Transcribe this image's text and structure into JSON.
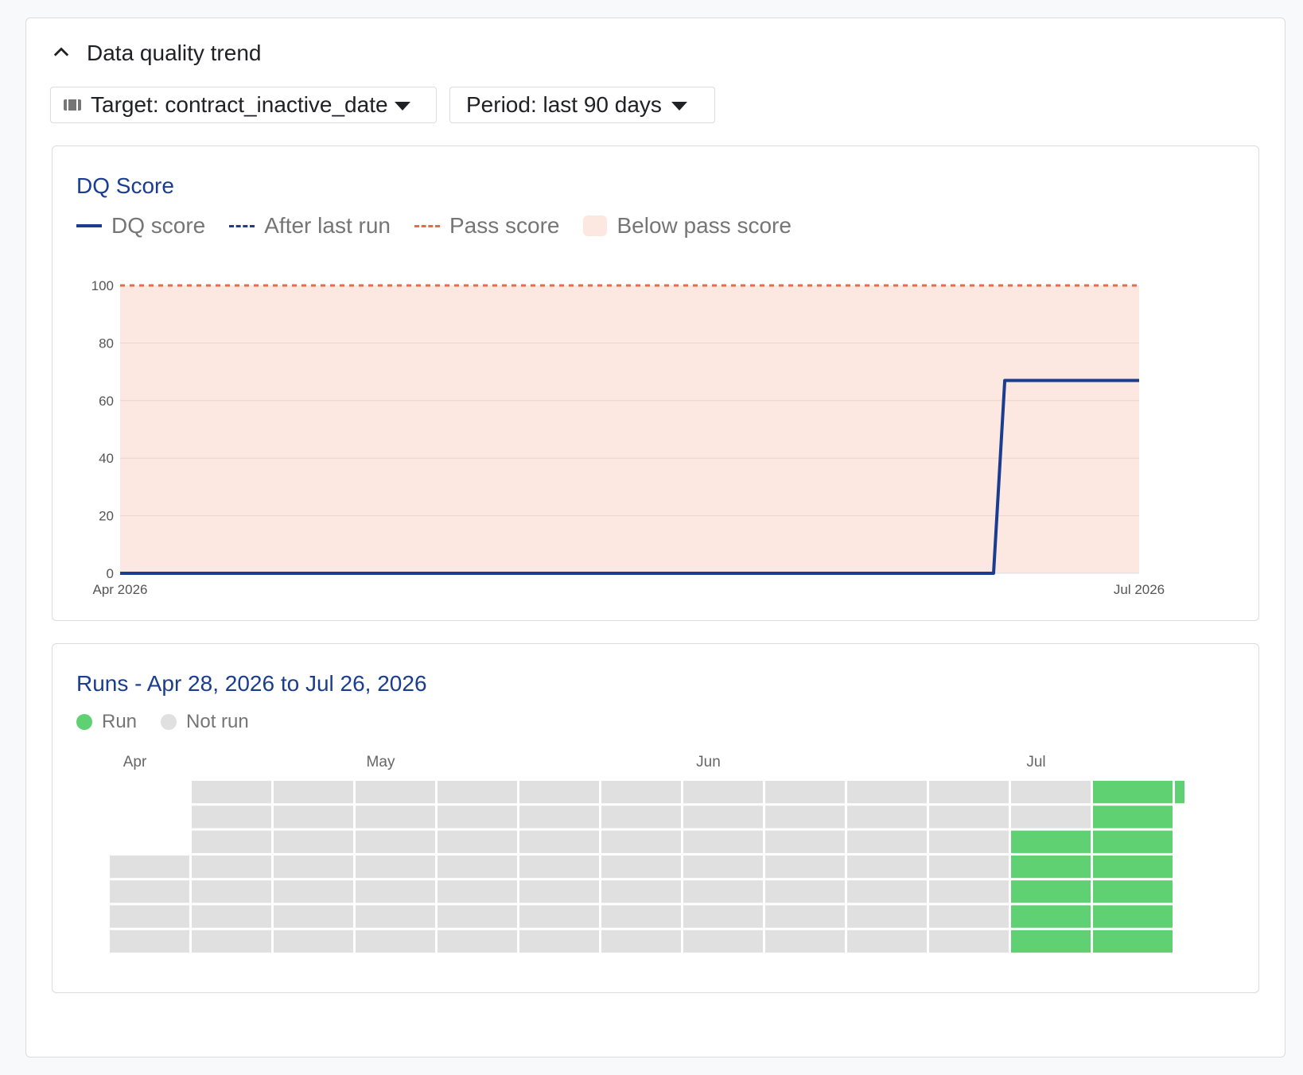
{
  "header": {
    "title": "Data quality trend",
    "toggle_icon": "chevron-up-icon"
  },
  "filters": {
    "target": {
      "icon": "table-icon",
      "label": "Target: contract_inactive_date"
    },
    "period": {
      "label": "Period: last 90 days"
    }
  },
  "dq_chart": {
    "title": "DQ Score",
    "legend": {
      "dq_score": "DQ score",
      "after_last_run": "After last run",
      "pass_score": "Pass score",
      "below_pass": "Below pass score"
    },
    "colors": {
      "line": "#1a3d8f",
      "pass": "#ee6a3a",
      "area": "#fce8e1",
      "grid": "#e6e6e6"
    }
  },
  "runs": {
    "title": "Runs - Apr 28, 2026 to Jul 26, 2026",
    "legend": {
      "run": "Run",
      "not_run": "Not run"
    },
    "month_labels": [
      "Apr",
      "May",
      "Jun",
      "Jul"
    ],
    "colors": {
      "run": "#5fd173",
      "not_run": "#e0e0e0"
    }
  },
  "chart_data": [
    {
      "type": "line",
      "title": "DQ Score",
      "xlabel": "",
      "ylabel": "",
      "ylim": [
        0,
        100
      ],
      "yticks": [
        0,
        20,
        40,
        60,
        80,
        100
      ],
      "xticks": [
        "Apr 2026",
        "Jul 2026"
      ],
      "pass_score": 100,
      "series": [
        {
          "name": "DQ score",
          "points": [
            {
              "x": "2026-04-01",
              "y": 0
            },
            {
              "x": "2026-06-18",
              "y": 0
            },
            {
              "x": "2026-06-19",
              "y": 67
            },
            {
              "x": "2026-07-01",
              "y": 67
            }
          ]
        }
      ],
      "grid": true,
      "legend_position": "top-left"
    },
    {
      "type": "heatmap",
      "title": "Runs - Apr 28, 2026 to Jul 26, 2026",
      "rows": 7,
      "weeks": [
        {
          "first_row": 3,
          "runs": [
            0,
            0,
            0,
            0
          ]
        },
        {
          "first_row": 0,
          "runs": [
            0,
            0,
            0,
            0,
            0,
            0,
            0
          ]
        },
        {
          "first_row": 0,
          "runs": [
            0,
            0,
            0,
            0,
            0,
            0,
            0
          ]
        },
        {
          "first_row": 0,
          "runs": [
            0,
            0,
            0,
            0,
            0,
            0,
            0
          ]
        },
        {
          "first_row": 0,
          "runs": [
            0,
            0,
            0,
            0,
            0,
            0,
            0
          ]
        },
        {
          "first_row": 0,
          "runs": [
            0,
            0,
            0,
            0,
            0,
            0,
            0
          ]
        },
        {
          "first_row": 0,
          "runs": [
            0,
            0,
            0,
            0,
            0,
            0,
            0
          ]
        },
        {
          "first_row": 0,
          "runs": [
            0,
            0,
            0,
            0,
            0,
            0,
            0
          ]
        },
        {
          "first_row": 0,
          "runs": [
            0,
            0,
            0,
            0,
            0,
            0,
            0
          ]
        },
        {
          "first_row": 0,
          "runs": [
            0,
            0,
            0,
            0,
            0,
            0,
            0
          ]
        },
        {
          "first_row": 0,
          "runs": [
            0,
            0,
            0,
            0,
            0,
            0,
            0
          ]
        },
        {
          "first_row": 0,
          "runs": [
            0,
            0,
            1,
            1,
            1,
            1,
            1
          ]
        },
        {
          "first_row": 0,
          "runs": [
            1,
            1,
            1,
            1,
            1,
            1,
            1
          ]
        },
        {
          "first_row": 0,
          "runs": [
            1
          ]
        }
      ],
      "month_labels": [
        {
          "label": "Apr",
          "week": 0
        },
        {
          "label": "May",
          "week": 3
        },
        {
          "label": "Jun",
          "week": 7
        },
        {
          "label": "Jul",
          "week": 11
        }
      ]
    }
  ]
}
